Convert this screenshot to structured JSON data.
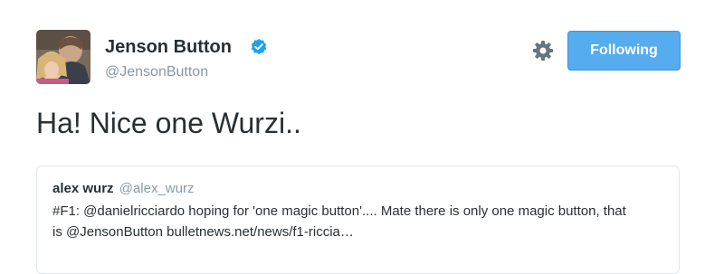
{
  "author": {
    "name": "Jenson Button",
    "handle": "@JensonButton"
  },
  "actions": {
    "follow_label": "Following"
  },
  "tweet": {
    "text": "Ha! Nice one Wurzi.."
  },
  "quoted_tweet": {
    "author_name": "alex wurz",
    "author_handle": "@alex_wurz",
    "text": "#F1: @danielricciardo hoping for 'one magic button'.... Mate there is only one magic button, that is @JensonButton  bulletnews.net/news/f1-riccia…"
  },
  "colors": {
    "accent": "#55acee",
    "verified": "#1da1f2",
    "muted": "#8899a6",
    "border": "#e1e8ed"
  }
}
